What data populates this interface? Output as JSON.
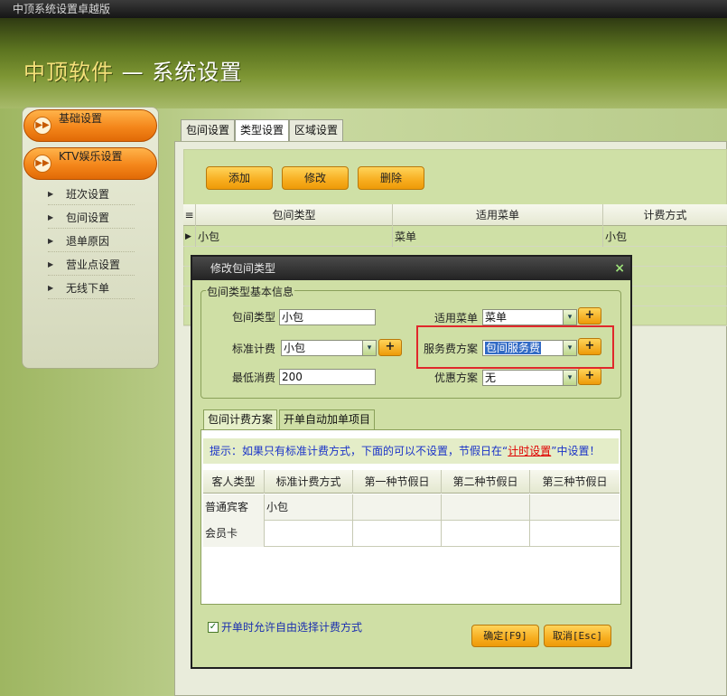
{
  "window": {
    "title": "中顶系统设置卓越版"
  },
  "banner": {
    "brand": "中顶软件",
    "dash": "—",
    "title": "系统设置"
  },
  "sidebar": {
    "basic_label": "基础设置",
    "ktv_label": "KTV娱乐设置",
    "items": [
      {
        "label": "班次设置"
      },
      {
        "label": "包间设置"
      },
      {
        "label": "退单原因"
      },
      {
        "label": "营业点设置"
      },
      {
        "label": "无线下单"
      }
    ]
  },
  "tabs": [
    {
      "label": "包间设置"
    },
    {
      "label": "类型设置",
      "active": true
    },
    {
      "label": "区域设置"
    }
  ],
  "toolbar": {
    "add": "添加",
    "edit": "修改",
    "delete": "删除"
  },
  "grid": {
    "row_header_glyph": "≡",
    "columns": [
      "包间类型",
      "适用菜单",
      "计费方式"
    ],
    "rows": [
      {
        "marker": "▶",
        "type": "小包",
        "menu": "菜单",
        "billing": "小包"
      }
    ]
  },
  "dialog": {
    "title": "修改包间类型",
    "close": "×",
    "basic_legend": "包间类型基本信息",
    "room_type_label": "包间类型",
    "room_type_value": "小包",
    "std_billing_label": "标准计费",
    "std_billing_value": "小包",
    "min_consume_label": "最低消费",
    "min_consume_value": "200",
    "menu_label": "适用菜单",
    "menu_value": "菜单",
    "service_fee_label": "服务费方案",
    "service_fee_value": "包间服务费",
    "discount_label": "优惠方案",
    "discount_value": "无",
    "plus": "+",
    "dropdown_glyph": "▾",
    "subtabs": [
      {
        "label": "包间计费方案",
        "active": true
      },
      {
        "label": "开单自动加单项目"
      }
    ],
    "hint": {
      "prefix": "提示：如果只有标准计费方式，下面的可以不设置，节假日在“",
      "link": "计时设置",
      "suffix": "”中设置！"
    },
    "fee_columns": [
      "客人类型",
      "标准计费方式",
      "第一种节假日",
      "第二种节假日",
      "第三种节假日"
    ],
    "fee_rows": [
      {
        "guest": "普通宾客",
        "std": "小包",
        "h1": "",
        "h2": "",
        "h3": ""
      },
      {
        "guest": "会员卡",
        "std": "",
        "h1": "",
        "h2": "",
        "h3": ""
      }
    ],
    "allow_free_choice_label": "开单时允许自由选择计费方式",
    "allow_free_choice_checked": "✓",
    "ok": "确定[F9]",
    "cancel": "取消[Esc]"
  },
  "colors": {
    "accent_orange": "#f4861a",
    "button_yellow": "#f7ad1f",
    "panel_green": "#cfdfa5",
    "highlight_red": "#e0282b"
  }
}
